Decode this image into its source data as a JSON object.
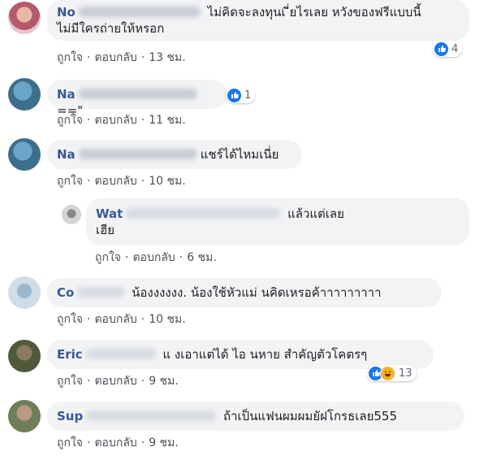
{
  "actions": {
    "like": "ถูกใจ",
    "reply": "ตอบกลับ",
    "sep": "·"
  },
  "comments": [
    {
      "name": "No",
      "text": "ไม่คิดจะลงทุนเ ี่ยไรเลย หวังของฟรีแบบนี้",
      "text2": "ไม่มีใครถ่ายให้หรอก",
      "time": "13 ชม.",
      "reaction_count": "4"
    },
    {
      "name": "Na",
      "text": "==\"",
      "time": "11 ชม.",
      "reaction_count": "1"
    },
    {
      "name": "Na",
      "text": "แชร์ได้ไหมเนี่ย",
      "time": "10 ชม."
    },
    {
      "name": "Wat",
      "text": "แล้วแต่เลย",
      "text2": "เฮีย",
      "time": "6 ชม."
    },
    {
      "name": "Co",
      "text": "น้องงงงงง. น้องใช้หัวแม่ นคิดเหรอค้าาาาาาาาา",
      "time": "10 ชม."
    },
    {
      "name": "Eric",
      "text": "แ งเอาแต่ได้ ไอ  นหาย สำคัญตัวโคตรๆ",
      "time": "9 ชม.",
      "reaction_count": "13"
    },
    {
      "name": "Sup",
      "text": "ถ้าเป็นแฟนผมผมยัฝโกรธเลย555",
      "time": "9 ชม."
    }
  ],
  "icons": {
    "like": "like-icon",
    "haha": "haha-icon"
  },
  "colors": {
    "name": "#385898",
    "bubble": "#f2f3f5",
    "like": "#1877f2",
    "haha": "#f7b125"
  }
}
